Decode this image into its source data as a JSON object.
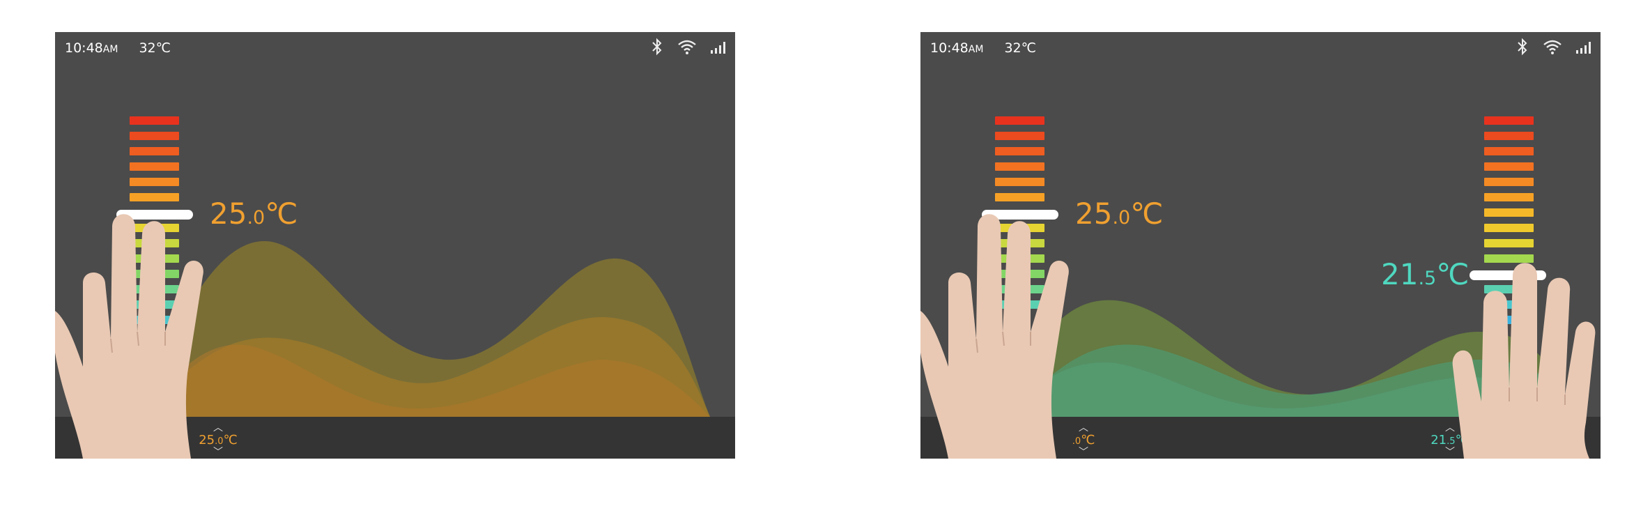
{
  "screens": [
    {
      "status": {
        "time": "10:48",
        "ampm": "AM",
        "temp": "32℃"
      },
      "zones": [
        {
          "setpoint_main": "25",
          "setpoint_dec": ".0",
          "unit": "℃",
          "color": "#f0a030",
          "stepper": {
            "main": "25",
            "dec": ".0",
            "unit": "℃"
          }
        }
      ]
    },
    {
      "status": {
        "time": "10:48",
        "ampm": "AM",
        "temp": "32℃"
      },
      "zones": [
        {
          "setpoint_main": "25",
          "setpoint_dec": ".0",
          "unit": "℃",
          "color": "#f0a030",
          "stepper": {
            "main": "",
            "dec": ".0",
            "unit": "℃"
          }
        },
        {
          "setpoint_main": "21",
          "setpoint_dec": ".5",
          "unit": "℃",
          "color": "#4fd8c0",
          "stepper": {
            "main": "21",
            "dec": ".5",
            "unit": "℃"
          }
        }
      ]
    }
  ],
  "scale_colors": [
    "#e8321e",
    "#ec4a1f",
    "#ef5d20",
    "#f27222",
    "#f48a24",
    "#f6a126",
    "#f5b828",
    "#f0c92c",
    "#e6d432",
    "#c8d83e",
    "#a4d84e",
    "#83d665",
    "#6cd48b",
    "#5ad0b1",
    "#4bc6cd",
    "#3ab3e0"
  ]
}
